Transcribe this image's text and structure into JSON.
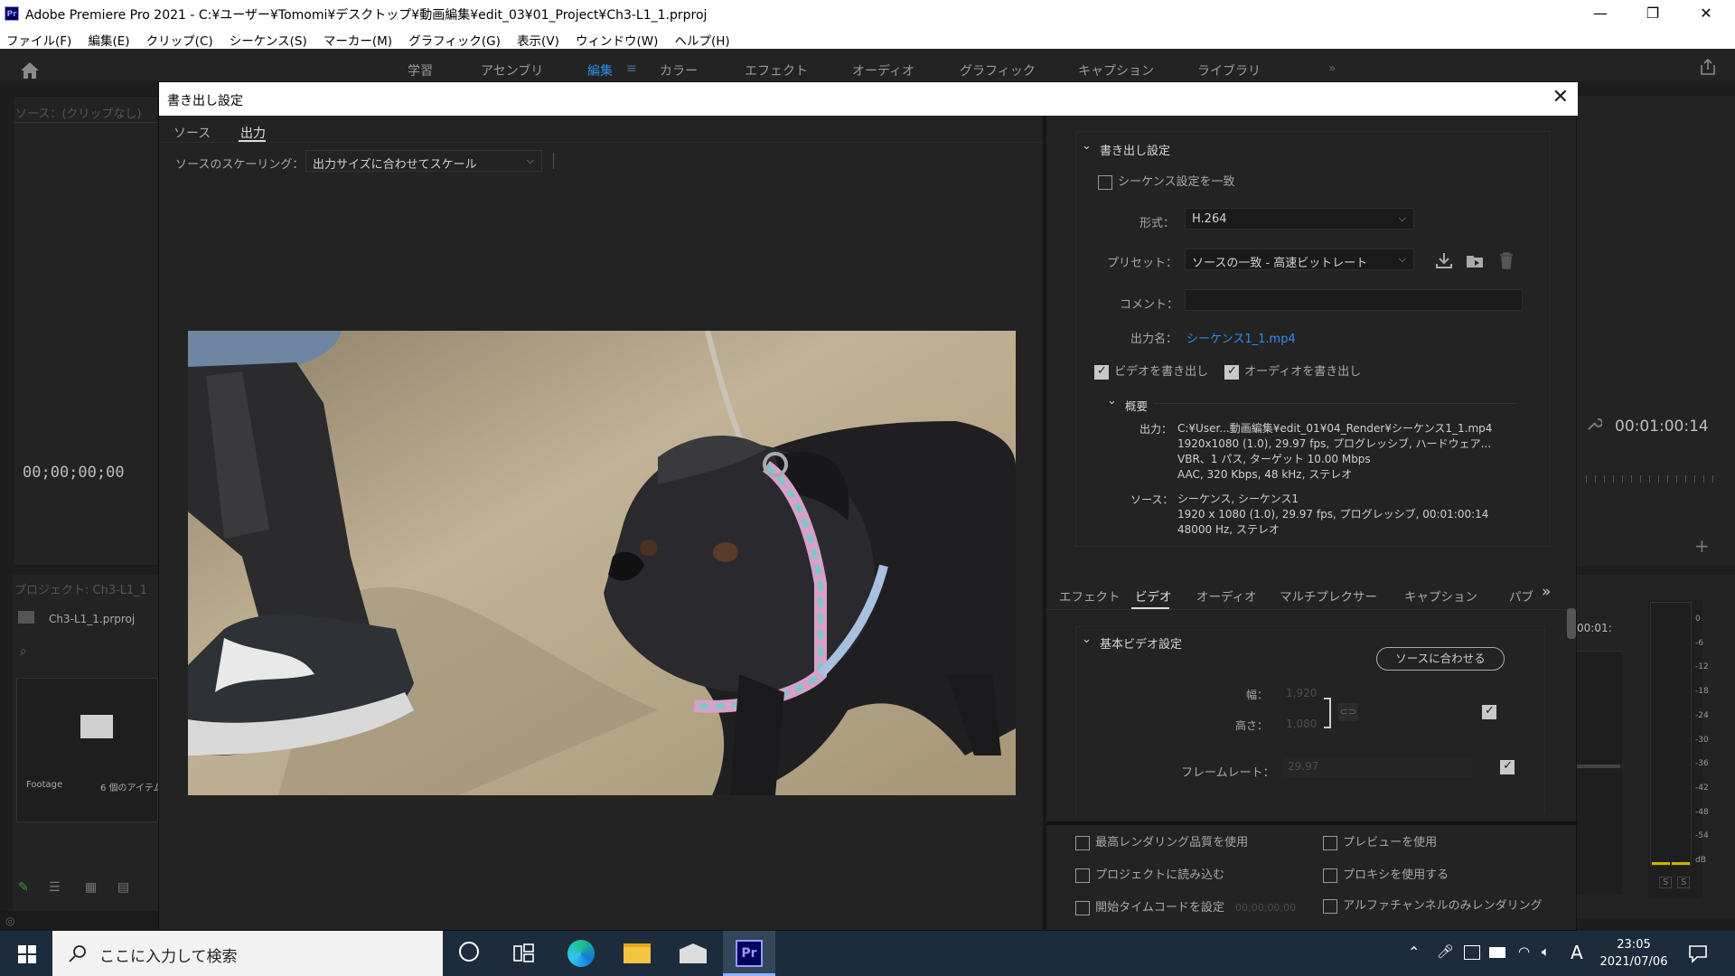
{
  "window": {
    "title": "Adobe Premiere Pro 2021 - C:¥ユーザー¥Tomomi¥デスクトップ¥動画編集¥edit_03¥01_Project¥Ch3-L1_1.prproj",
    "app_icon": "Pr"
  },
  "menu": [
    "ファイル(F)",
    "編集(E)",
    "クリップ(C)",
    "シーケンス(S)",
    "マーカー(M)",
    "グラフィック(G)",
    "表示(V)",
    "ウィンドウ(W)",
    "ヘルプ(H)"
  ],
  "workspaces": [
    "学習",
    "アセンブリ",
    "編集",
    "カラー",
    "エフェクト",
    "オーディオ",
    "グラフィック",
    "キャプション",
    "ライブラリ"
  ],
  "background": {
    "source_panel_label": "ソース：(クリップなし)",
    "source_timecode": "00;00;00;00",
    "program_timecode": "00:01:00:14",
    "project_panel_label": "プロジェクト: Ch3-L1_1",
    "project_file": "Ch3-L1_1.prproj",
    "bin_name": "Footage",
    "bin_count": "6 個のアイテム",
    "timeline_timecode": "00:01:",
    "meter_scale": [
      "0",
      "-6",
      "-12",
      "-18",
      "-24",
      "-30",
      "-36",
      "-42",
      "-48",
      "-54",
      "dB"
    ],
    "meter_solo": [
      "S",
      "S"
    ]
  },
  "dialog": {
    "title": "書き出し設定",
    "left_tabs": [
      "ソース",
      "出力"
    ],
    "active_left_tab": "出力",
    "source_scaling_label": "ソースのスケーリング：",
    "source_scaling_value": "出力サイズに合わせてスケール",
    "export_settings": {
      "section_title": "書き出し設定",
      "match_sequence_label": "シーケンス設定を一致",
      "match_sequence_checked": false,
      "format_label": "形式：",
      "format_value": "H.264",
      "preset_label": "プリセット：",
      "preset_value": "ソースの一致 - 高速ビットレート",
      "comment_label": "コメント：",
      "comment_value": "",
      "output_name_label": "出力名：",
      "output_name_value": "シーケンス1_1.mp4",
      "export_video_label": "ビデオを書き出し",
      "export_video_checked": true,
      "export_audio_label": "オーディオを書き出し",
      "export_audio_checked": true
    },
    "summary": {
      "title": "概要",
      "output_label": "出力：",
      "output_lines": [
        "C:¥User...動画編集¥edit_01¥04_Render¥シーケンス1_1.mp4",
        "1920x1080 (1.0), 29.97 fps, プログレッシブ, ハードウェア...",
        "VBR、1 パス, ターゲット 10.00 Mbps",
        "AAC, 320 Kbps, 48 kHz, ステレオ"
      ],
      "source_label": "ソース：",
      "source_lines": [
        "シーケンス, シーケンス1",
        "1920 x 1080 (1.0), 29.97 fps, プログレッシブ, 00:01:00:14",
        "48000 Hz, ステレオ"
      ]
    },
    "settings_tabs": [
      "エフェクト",
      "ビデオ",
      "オーディオ",
      "マルチプレクサー",
      "キャプション",
      "パブ"
    ],
    "active_settings_tab": "ビデオ",
    "basic_video": {
      "title": "基本ビデオ設定",
      "match_source_button": "ソースに合わせる",
      "width_label": "幅：",
      "width_value": "1,920",
      "height_label": "高さ：",
      "height_value": "1,080",
      "framerate_label": "フレームレート：",
      "framerate_value": "29.97"
    },
    "bottom_options": {
      "max_render_quality": "最高レンダリング品質を使用",
      "use_previews": "プレビューを使用",
      "import_into_project": "プロジェクトに読み込む",
      "use_proxies": "プロキシを使用する",
      "set_start_timecode": "開始タイムコードを設定",
      "start_timecode_value": "00;00;00;00",
      "render_alpha_only": "アルファチャンネルのみレンダリング"
    }
  },
  "taskbar": {
    "search_placeholder": "ここに入力して検索",
    "time": "23:05",
    "date": "2021/07/06",
    "ime": "A"
  },
  "colors": {
    "accent": "#2d8ceb",
    "panel": "#232323",
    "taskbar": "#1c2c3c"
  }
}
